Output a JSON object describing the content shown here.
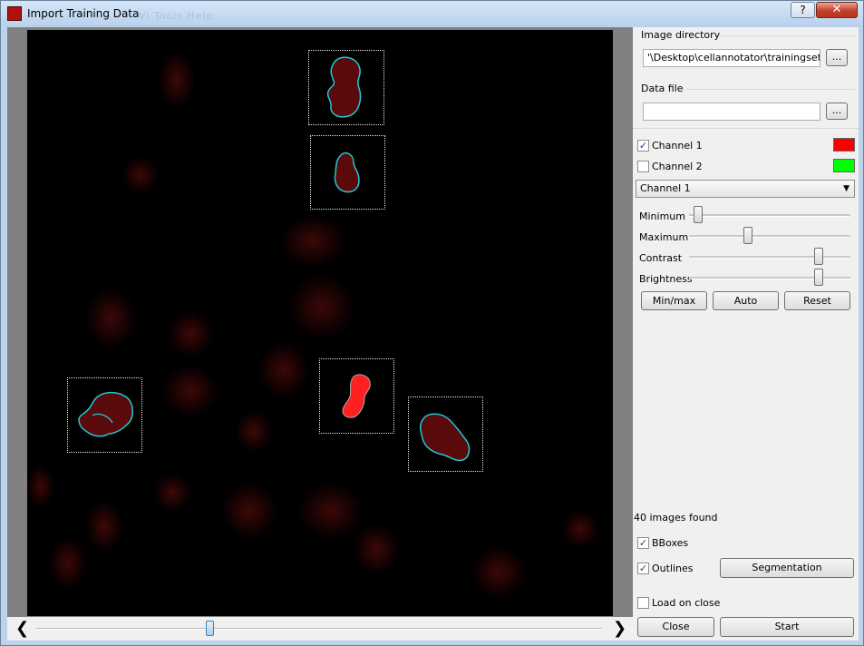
{
  "window": {
    "title": "Import Training Data",
    "ghost_menu": "Vi  Tools  Help",
    "help_glyph": "?",
    "close_glyph": "✕"
  },
  "panel": {
    "image_directory_label": "Image directory",
    "image_directory_value": "'\\Desktop\\cellannotator\\trainingset-felix",
    "browse_label": "...",
    "data_file_label": "Data file",
    "data_file_value": "",
    "channels": [
      {
        "label": "Channel 1",
        "checked": true,
        "color": "#ff0000"
      },
      {
        "label": "Channel 2",
        "checked": false,
        "color": "#00ff00"
      }
    ],
    "channel_select_value": "Channel 1",
    "sliders": {
      "minimum_label": "Minimum",
      "minimum_level": 0.03,
      "maximum_label": "Maximum",
      "maximum_level": 0.36,
      "contrast_label": "Contrast",
      "contrast_level": 0.82,
      "brightness_label": "Brightness",
      "brightness_level": 0.82
    },
    "min_max_label": "Min/max",
    "auto_label": "Auto",
    "reset_label": "Reset",
    "images_found_text": "40 images found",
    "bboxes_label": "BBoxes",
    "bboxes_checked": true,
    "outlines_label": "Outlines",
    "outlines_checked": true,
    "segmentation_label": "Segmentation",
    "load_on_close_label": "Load on close",
    "load_on_close_checked": false,
    "close_label": "Close",
    "start_label": "Start"
  },
  "viewer": {
    "prev_glyph": "❮",
    "next_glyph": "❯",
    "scroll_level": 0.3,
    "outline_color": "#22c8d8",
    "highlight_color": "#ff2020"
  }
}
